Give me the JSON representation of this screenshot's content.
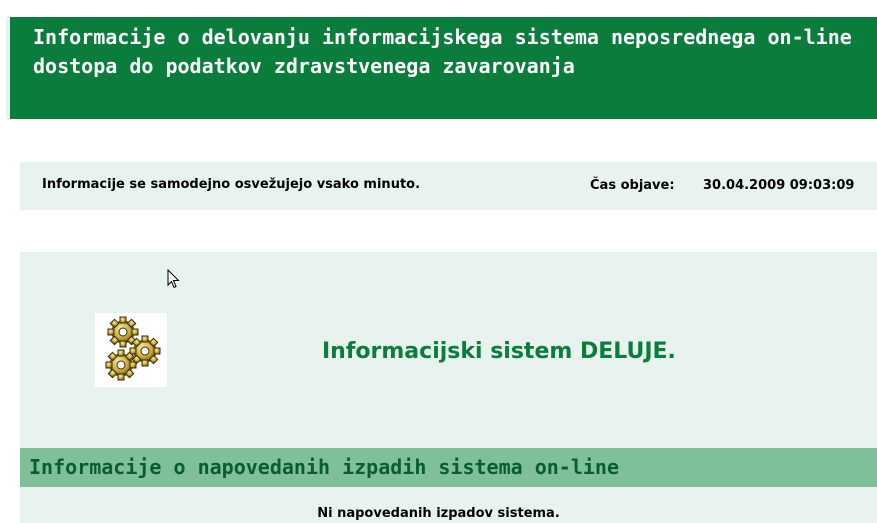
{
  "header": {
    "title": "Informacije o delovanju informacijskega sistema neposrednega on-line dostopa do podatkov zdravstvenega zavarovanja"
  },
  "info": {
    "refresh_text": "Informacije se samodejno osvežujejo vsako minuto.",
    "time_label": "Čas objave:",
    "time_value": "30.04.2009 09:03:09"
  },
  "status": {
    "icon": "gears-icon",
    "text": "Informacijski sistem DELUJE."
  },
  "outages": {
    "title": "Informacije o napovedanih izpadih sistema on-line",
    "empty_text": "Ni napovedanih izpadov sistema."
  },
  "colors": {
    "brand_green": "#0a7d3c",
    "panel_bg": "#e8f2ee",
    "section_header_bg": "#7fbf9a"
  }
}
